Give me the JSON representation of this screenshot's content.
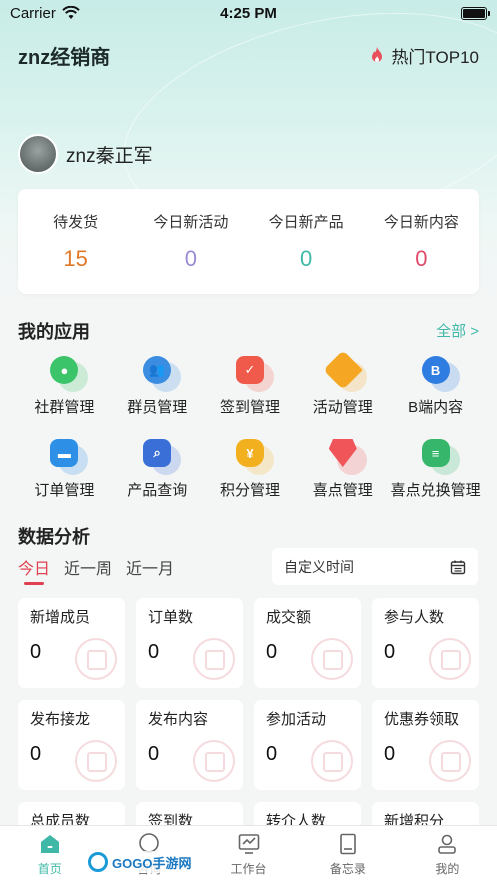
{
  "status_bar": {
    "carrier": "Carrier",
    "time": "4:25 PM"
  },
  "header": {
    "title": "znz经销商",
    "hot_label": "热门TOP10"
  },
  "user": {
    "name": "znz秦正军"
  },
  "stats": [
    {
      "label": "待发货",
      "value": "15",
      "color": "#e07a2a"
    },
    {
      "label": "今日新活动",
      "value": "0",
      "color": "#9b8ad4"
    },
    {
      "label": "今日新产品",
      "value": "0",
      "color": "#3fb8a8"
    },
    {
      "label": "今日新内容",
      "value": "0",
      "color": "#e04a6a"
    }
  ],
  "apps_section": {
    "title": "我的应用",
    "all_label": "全部 >",
    "items": [
      {
        "label": "社群管理",
        "icon": "community-icon",
        "color": "#3cc46a"
      },
      {
        "label": "群员管理",
        "icon": "members-icon",
        "color": "#3a8de0"
      },
      {
        "label": "签到管理",
        "icon": "calendar-check-icon",
        "color": "#f05a4a"
      },
      {
        "label": "活动管理",
        "icon": "tag-icon",
        "color": "#f5a623"
      },
      {
        "label": "B端内容",
        "icon": "b-content-icon",
        "color": "#2f7de1"
      },
      {
        "label": "订单管理",
        "icon": "order-icon",
        "color": "#2d8fe6"
      },
      {
        "label": "产品查询",
        "icon": "product-search-icon",
        "color": "#3b6fd8"
      },
      {
        "label": "积分管理",
        "icon": "points-bag-icon",
        "color": "#f2b01e"
      },
      {
        "label": "喜点管理",
        "icon": "gem-icon",
        "color": "#f0555a"
      },
      {
        "label": "喜点兑换管理",
        "icon": "exchange-coin-icon",
        "color": "#35b66b"
      }
    ]
  },
  "analytics": {
    "title": "数据分析",
    "tabs": [
      "今日",
      "近一周",
      "近一月"
    ],
    "active_tab": 0,
    "date_picker_label": "自定义时间",
    "metrics": [
      {
        "label": "新增成员",
        "value": "0"
      },
      {
        "label": "订单数",
        "value": "0"
      },
      {
        "label": "成交额",
        "value": "0"
      },
      {
        "label": "参与人数",
        "value": "0"
      },
      {
        "label": "发布接龙",
        "value": "0"
      },
      {
        "label": "发布内容",
        "value": "0"
      },
      {
        "label": "参加活动",
        "value": "0"
      },
      {
        "label": "优惠券领取",
        "value": "0"
      },
      {
        "label": "总成员数",
        "value": ""
      },
      {
        "label": "签到数",
        "value": ""
      },
      {
        "label": "转介人数",
        "value": ""
      },
      {
        "label": "新增积分",
        "value": ""
      }
    ]
  },
  "tabbar": [
    {
      "label": "首页",
      "icon": "home-icon",
      "active": true
    },
    {
      "label": "咨询",
      "icon": "chat-icon",
      "active": false
    },
    {
      "label": "工作台",
      "icon": "workbench-icon",
      "active": false
    },
    {
      "label": "备忘录",
      "icon": "memo-icon",
      "active": false
    },
    {
      "label": "我的",
      "icon": "profile-icon",
      "active": false
    }
  ],
  "watermark": {
    "text": "GOGO手游网"
  },
  "colors": {
    "accent": "#3fb8a8",
    "active_tab": "#e04050"
  }
}
